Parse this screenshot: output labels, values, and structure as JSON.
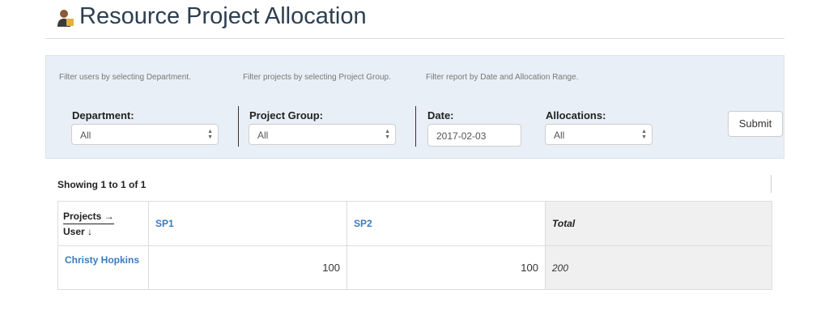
{
  "header": {
    "title": "Resource Project Allocation",
    "icon": "user-icon"
  },
  "filters": {
    "hint_department": "Filter users by selecting Department.",
    "hint_project_group": "Filter projects by selecting Project Group.",
    "hint_date_alloc": "Filter report by Date and Allocation Range.",
    "department": {
      "label": "Department:",
      "value": "All"
    },
    "project_group": {
      "label": "Project Group:",
      "value": "All"
    },
    "date": {
      "label": "Date:",
      "value": "2017-02-03"
    },
    "allocations": {
      "label": "Allocations:",
      "value": "All"
    },
    "submit_label": "Submit"
  },
  "report": {
    "showing": "Showing 1 to 1 of 1",
    "corner_top": "Projects →",
    "corner_bottom": "User ↓",
    "columns": [
      "SP1",
      "SP2",
      "Total"
    ],
    "rows": [
      {
        "user": "Christy Hopkins",
        "values": [
          "100",
          "100"
        ],
        "total": "200"
      }
    ]
  },
  "colors": {
    "link": "#3a7bbf",
    "title": "#2c3e50",
    "panel": "#e9eff6"
  }
}
